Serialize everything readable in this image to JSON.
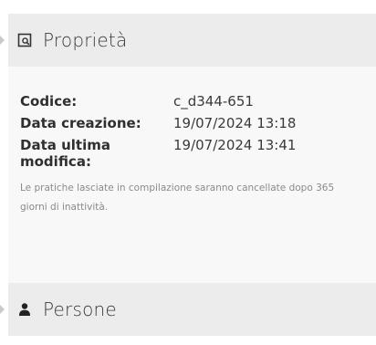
{
  "properties": {
    "title": "Proprietà",
    "icon": "document-search-icon",
    "rows": [
      {
        "label": "Codice:",
        "value": "c_d344-651"
      },
      {
        "label": "Data creazione:",
        "value": "19/07/2024 13:18"
      },
      {
        "label": "Data ultima modifica:",
        "value": "19/07/2024 13:41"
      }
    ],
    "note": "Le pratiche lasciate in compilazione saranno cancellate dopo 365 giorni di inattività."
  },
  "persons": {
    "title": "Persone",
    "icon": "person-icon"
  },
  "colors": {
    "header_bg": "#ececec",
    "body_bg": "#f8f8f8",
    "note_text": "#8a8a8a"
  }
}
